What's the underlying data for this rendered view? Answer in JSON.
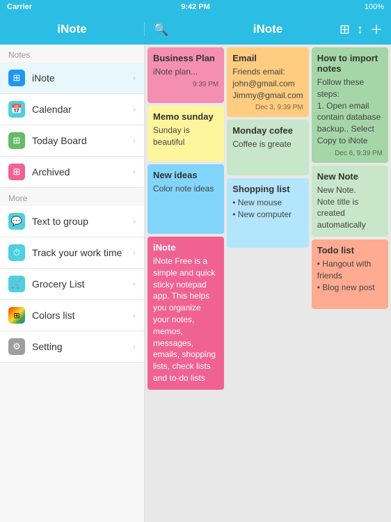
{
  "statusBar": {
    "carrier": "Carrier",
    "time": "9:42 PM",
    "battery": "100%"
  },
  "topBar": {
    "leftTitle": "iNote",
    "rightTitle": "iNote"
  },
  "sidebar": {
    "notesHeader": "Notes",
    "moreHeader": "More",
    "items": [
      {
        "id": "inote",
        "label": "iNote",
        "iconType": "grid",
        "iconColor": "blue",
        "active": true
      },
      {
        "id": "calendar",
        "label": "Calendar",
        "iconType": "calendar",
        "iconColor": "teal",
        "active": false
      },
      {
        "id": "today-board",
        "label": "Today Board",
        "iconType": "grid",
        "iconColor": "green",
        "active": false
      },
      {
        "id": "archived",
        "label": "Archived",
        "iconType": "grid",
        "iconColor": "pink",
        "active": false
      },
      {
        "id": "text-to-group",
        "label": "Text to group",
        "iconType": "chat",
        "iconColor": "teal",
        "active": false
      },
      {
        "id": "track-work-time",
        "label": "Track your work time",
        "iconType": "clock",
        "iconColor": "teal",
        "active": false
      },
      {
        "id": "grocery-list",
        "label": "Grocery List",
        "iconType": "list",
        "iconColor": "teal",
        "active": false
      },
      {
        "id": "colors-list",
        "label": "Colors list",
        "iconType": "colorful",
        "iconColor": "colorful",
        "active": false
      },
      {
        "id": "setting",
        "label": "Setting",
        "iconType": "gear",
        "iconColor": "grey",
        "active": false
      }
    ]
  },
  "notes": {
    "columns": [
      {
        "cards": [
          {
            "id": "business-plan",
            "title": "Business Plan",
            "body": "iNote plan...",
            "timestamp": "9:39 PM",
            "color": "pink"
          },
          {
            "id": "memo-sunday",
            "title": "Memo sunday",
            "body": "Sunday is beautiful",
            "timestamp": "",
            "color": "yellow"
          },
          {
            "id": "new-ideas",
            "title": "New ideas",
            "body": "Color note ideas",
            "timestamp": "",
            "color": "blue"
          },
          {
            "id": "inote-desc",
            "title": "iNote",
            "body": "iNote Free is a simple and quick sticky notepad app. This  helps you organize your notes, memos, messages, emails, shopping lists, check lists and to-do lists",
            "timestamp": "",
            "color": "magenta"
          }
        ]
      },
      {
        "cards": [
          {
            "id": "email",
            "title": "Email",
            "body": "Friends email:\njohn@gmail.com\nJimmy@gmail.com",
            "timestamp": "Dec 3, 9:39 PM",
            "color": "orange"
          },
          {
            "id": "monday-cofee",
            "title": "Monday cofee",
            "body": "Coffee is greate",
            "timestamp": "",
            "color": "light-green"
          },
          {
            "id": "shopping-list",
            "title": "Shopping list",
            "body": "• New mouse\n• New computer",
            "timestamp": "",
            "color": "light-blue"
          }
        ]
      },
      {
        "cards": [
          {
            "id": "how-to-import",
            "title": "How to import notes",
            "body": "Follow these steps:\n1. Open email contain database backup.. Select Copy to iNote",
            "timestamp": "Dec 6, 9:39 PM",
            "color": "green"
          },
          {
            "id": "new-note",
            "title": "New Note",
            "body": "New Note.\nNote title is created automatically",
            "timestamp": "",
            "color": "light-green"
          },
          {
            "id": "todo-list",
            "title": "Todo list",
            "body": "• Hangout with friends\n• Blog new post",
            "timestamp": "",
            "color": "salmon"
          }
        ]
      }
    ]
  }
}
